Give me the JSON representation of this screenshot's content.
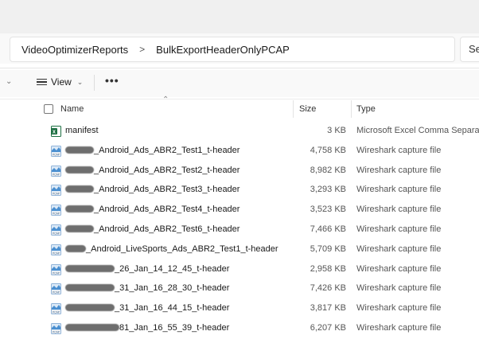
{
  "breadcrumb": {
    "items": [
      "VideoOptimizerReports",
      "BulkExportHeaderOnlyPCAP"
    ],
    "separator": ">"
  },
  "search": {
    "placeholder": "Se"
  },
  "toolbar": {
    "view_label": "View",
    "more_label": "•••"
  },
  "columns": {
    "name": "Name",
    "size": "Size",
    "type": "Type"
  },
  "files": [
    {
      "icon": "excel-file-icon",
      "prefix_redacted": false,
      "name": "manifest",
      "size": "3 KB",
      "type": "Microsoft Excel Comma Separa..."
    },
    {
      "icon": "wireshark-file-icon",
      "prefix_redacted": true,
      "name": "_Android_Ads_ABR2_Test1_t-header",
      "size": "4,758 KB",
      "type": "Wireshark capture file"
    },
    {
      "icon": "wireshark-file-icon",
      "prefix_redacted": true,
      "name": "_Android_Ads_ABR2_Test2_t-header",
      "size": "8,982 KB",
      "type": "Wireshark capture file"
    },
    {
      "icon": "wireshark-file-icon",
      "prefix_redacted": true,
      "name": "_Android_Ads_ABR2_Test3_t-header",
      "size": "3,293 KB",
      "type": "Wireshark capture file"
    },
    {
      "icon": "wireshark-file-icon",
      "prefix_redacted": true,
      "name": "_Android_Ads_ABR2_Test4_t-header",
      "size": "3,523 KB",
      "type": "Wireshark capture file"
    },
    {
      "icon": "wireshark-file-icon",
      "prefix_redacted": true,
      "name": "_Android_Ads_ABR2_Test6_t-header",
      "size": "7,466 KB",
      "type": "Wireshark capture file"
    },
    {
      "icon": "wireshark-file-icon",
      "prefix_redacted": true,
      "name": "_Android_LiveSports_Ads_ABR2_Test1_t-header",
      "size": "5,709 KB",
      "type": "Wireshark capture file"
    },
    {
      "icon": "wireshark-file-icon",
      "prefix_redacted": true,
      "name": "_26_Jan_14_12_45_t-header",
      "size": "2,958 KB",
      "type": "Wireshark capture file"
    },
    {
      "icon": "wireshark-file-icon",
      "prefix_redacted": true,
      "name": "_31_Jan_16_28_30_t-header",
      "size": "7,426 KB",
      "type": "Wireshark capture file"
    },
    {
      "icon": "wireshark-file-icon",
      "prefix_redacted": true,
      "name": "_31_Jan_16_44_15_t-header",
      "size": "3,817 KB",
      "type": "Wireshark capture file"
    },
    {
      "icon": "wireshark-file-icon",
      "prefix_redacted": true,
      "name": "81_Jan_16_55_39_t-header",
      "size": "6,207 KB",
      "type": "Wireshark capture file"
    }
  ],
  "colors": {
    "excel_green": "#1d6f42",
    "wireshark_blue": "#4a8fd0",
    "redaction": "#6e6e6e"
  }
}
